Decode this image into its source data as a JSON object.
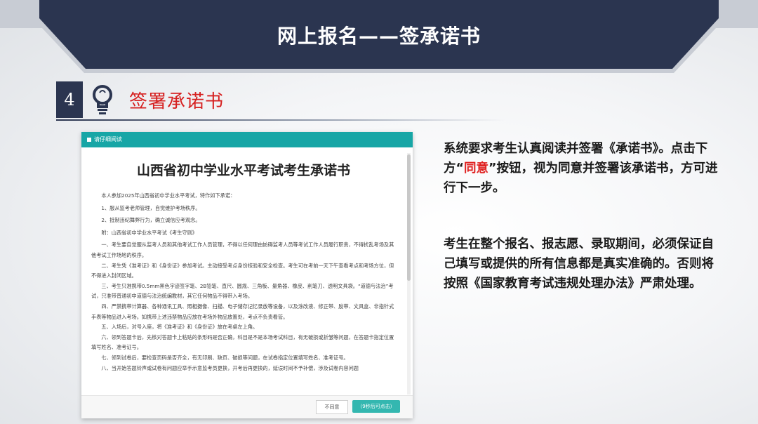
{
  "banner": {
    "title": "网上报名——签承诺书"
  },
  "section": {
    "number": "4",
    "title": "签署承诺书"
  },
  "dialog": {
    "header_label": "请仔细阅读",
    "doc_title": "山西省初中学业水平考试考生承诺书",
    "paragraphs": [
      "本人参加2025年山西省初中学业水平考试，特作如下承诺：",
      "1、服从监考老师管理，自觉维护考场秩序。",
      "2、抵制违纪舞弊行为，确立诚信应考观念。",
      "附：山西省初中学业水平考试《考生守则》",
      "一、考生要自觉服从监考人员和其他考试工作人员管理，不得以任何理由妨碍监考人员等考试工作人员履行职责，不得扰乱考场及其他考试工作场地的秩序。",
      "二、考生凭《准考证》和《身份证》参加考试。主动接受考点身份核验和安全检查。考生可在考前一天下午查看考点和考场方位，但不得进入封闭区域。",
      "三、考生只准携带0.5mm黑色字迹签字笔、2B铅笔、直尺、圆规、三角板、量角器、橡皮、削笔刀、透明文具袋。“道德与法治”考试，只准带普通初中道德与法治统编教材，其它任何物品不得带入考场。",
      "四、严禁携带计算器、各种通讯工具、照相摄像、扫描、电子储存记忆录放等设备，以及涂改液、修正带、胶带、文具盒、非指针式手表等物品进入考场。如携带上述违禁物品应放在考场外物品放置处，考点不负责看管。",
      "五、入场后，对号入座，将《准考证》和《身份证》放在考桌左上角。",
      "六、领到答题卡后，先核对答题卡上粘贴的条形码是否正确，科目是不是本场考试科目，有无破损或折皱等问题，在答题卡指定位置填写姓名、准考证号。",
      "七、领到试卷后，要检查页码是否齐全，有无印刷、缺页、破损等问题，在试卷指定位置填写姓名、准考证号。",
      "八、当开始答题铃声或试卷有问题应举手示意监考员更换，开考后再更换的，延误时间不予补偿，涉及试卷内容问题"
    ],
    "btn_disagree": "不同意",
    "btn_agree": "（9秒后可点击）"
  },
  "explain": {
    "p1_before": "系统要求考生认真阅读并签署《承诺书》。点击下方“",
    "p1_highlight": "同意",
    "p1_after": "”按钮，视为同意并签署该承诺书，方可进行下一步。",
    "p2": "考生在整个报名、报志愿、录取期间，必须保证自己填写或提供的所有信息都是真实准确的。否则将按照《国家教育考试违规处理办法》严肃处理。"
  },
  "colors": {
    "banner": "#2b3550",
    "accent_red": "#e02020",
    "teal": "#17a6a6"
  }
}
